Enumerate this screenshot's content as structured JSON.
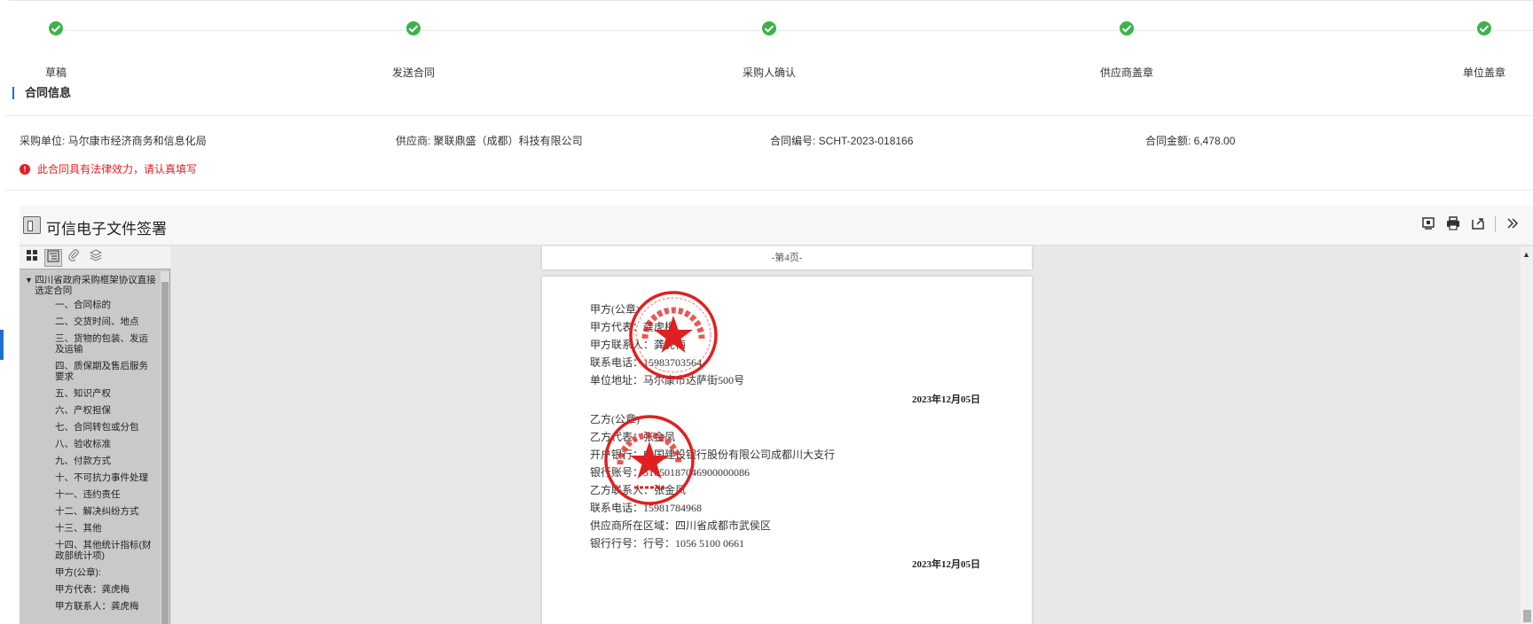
{
  "steps": [
    {
      "label": "草稿",
      "state": "done"
    },
    {
      "label": "发送合同",
      "state": "done"
    },
    {
      "label": "采购人确认",
      "state": "done"
    },
    {
      "label": "供应商盖章",
      "state": "done"
    },
    {
      "label": "单位盖章",
      "state": "done"
    }
  ],
  "section": {
    "title": "合同信息"
  },
  "info": {
    "purchaser": "采购单位: 马尔康市经济商务和信息化局",
    "supplier": "供应商: 聚联鼎盛（成都）科技有限公司",
    "contract_no": "合同编号: SCHT-2023-018166",
    "amount": "合同金额: 6,478.00"
  },
  "warning": "此合同具有法律效力，请认真填写",
  "viewer": {
    "title": "可信电子文件签署",
    "toolbar_icons": [
      "stamp-icon",
      "print-icon",
      "export-icon",
      "expand-right-icon"
    ]
  },
  "sidebar": {
    "tabs": [
      "thumbnails-icon",
      "outline-icon",
      "attachment-icon",
      "layers-icon"
    ],
    "root": "四川省政府采购框架协议直接选定合同",
    "items": [
      "一、合同标的",
      "二、交货时间、地点",
      "三、货物的包装、发运及运输",
      "四、质保期及售后服务要求",
      "五、知识产权",
      "六、产权担保",
      "七、合同转包或分包",
      "八、验收标准",
      "九、付款方式",
      "十、不可抗力事件处理",
      "十一、违约责任",
      "十二、解决纠纷方式",
      "十三、其他",
      "十四、其他统计指标(财政部统计项)",
      "甲方(公章):",
      "甲方代表：龚虎梅",
      "甲方联系人：龚虎梅"
    ]
  },
  "document": {
    "page_footer": "-第4页-",
    "party_a": [
      "甲方(公章)",
      "甲方代表：龚虎梅",
      "甲方联系人：龚虎梅",
      "联系电话：15983703564",
      "单位地址：马尔康市达萨街500号"
    ],
    "date_a": "2023年12月05日",
    "party_b": [
      "乙方(公章)",
      "乙方代表：张金凤",
      "开户银行：中国建设银行股份有限公司成都川大支行",
      "银行账号：51050187046900000086",
      "乙方联系人：张金凤",
      "联系电话：15981784968",
      "供应商所在区域：四川省成都市武侯区",
      "银行行号：行号：1056 5100 0661"
    ],
    "date_b": "2023年12月05日"
  },
  "colors": {
    "step_done": "#3cb34a",
    "accent": "#1f6fd1",
    "warning": "#e02020",
    "seal": "#e02020"
  }
}
